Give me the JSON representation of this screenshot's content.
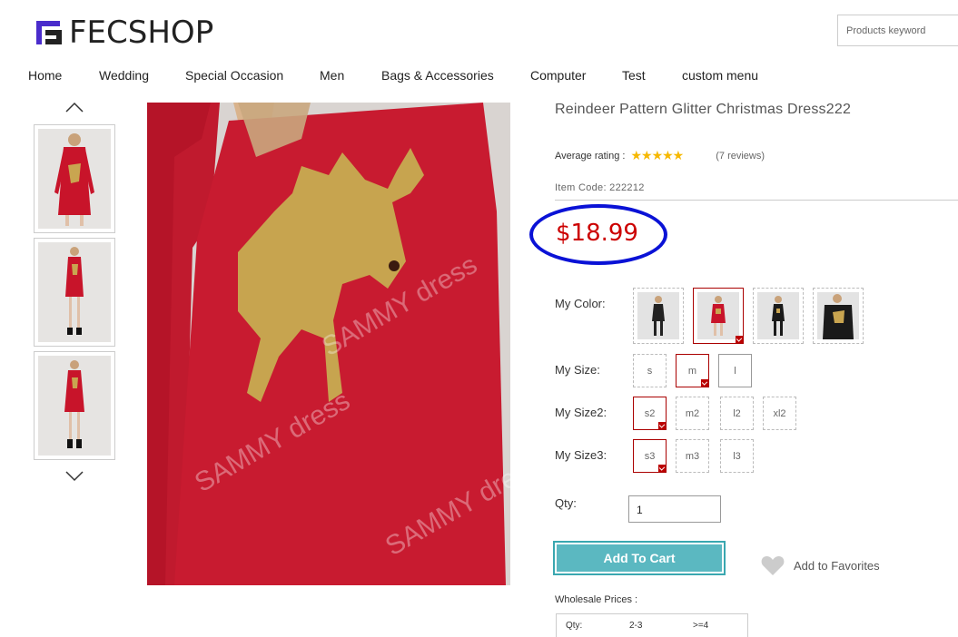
{
  "brand": {
    "logo_text": "FECSHOP",
    "accent": "#4a2ccc"
  },
  "search": {
    "placeholder": "Products keyword"
  },
  "nav": {
    "items": [
      {
        "label": "Home"
      },
      {
        "label": "Wedding"
      },
      {
        "label": "Special Occasion"
      },
      {
        "label": "Men"
      },
      {
        "label": "Bags & Accessories"
      },
      {
        "label": "Computer"
      },
      {
        "label": "Test"
      },
      {
        "label": "custom menu"
      }
    ]
  },
  "gallery": {
    "up_icon": "chevron-up-icon",
    "down_icon": "chevron-down-icon"
  },
  "product": {
    "title": "Reindeer Pattern Glitter Christmas Dress222",
    "rating_label": "Average rating :",
    "stars": "★★★★★",
    "reviews": "(7 reviews)",
    "item_code": "Item Code: 222212",
    "price": "$18.99",
    "price_color": "#cc0000",
    "highlight_color": "#0a12d6"
  },
  "options": {
    "color_label": "My Color:",
    "size_label": "My Size:",
    "size2_label": "My Size2:",
    "size3_label": "My Size3:",
    "sizes": [
      "s",
      "m",
      "l"
    ],
    "sizes2": [
      "s2",
      "m2",
      "l2",
      "xl2"
    ],
    "sizes3": [
      "s3",
      "m3",
      "l3"
    ]
  },
  "qty": {
    "label": "Qty:",
    "value": "1"
  },
  "actions": {
    "add_to_cart": "Add To Cart",
    "add_to_favorites": "Add to Favorites"
  },
  "wholesale": {
    "label": "Wholesale Prices :",
    "headers": [
      "Qty:",
      "2-3",
      ">=4"
    ]
  }
}
